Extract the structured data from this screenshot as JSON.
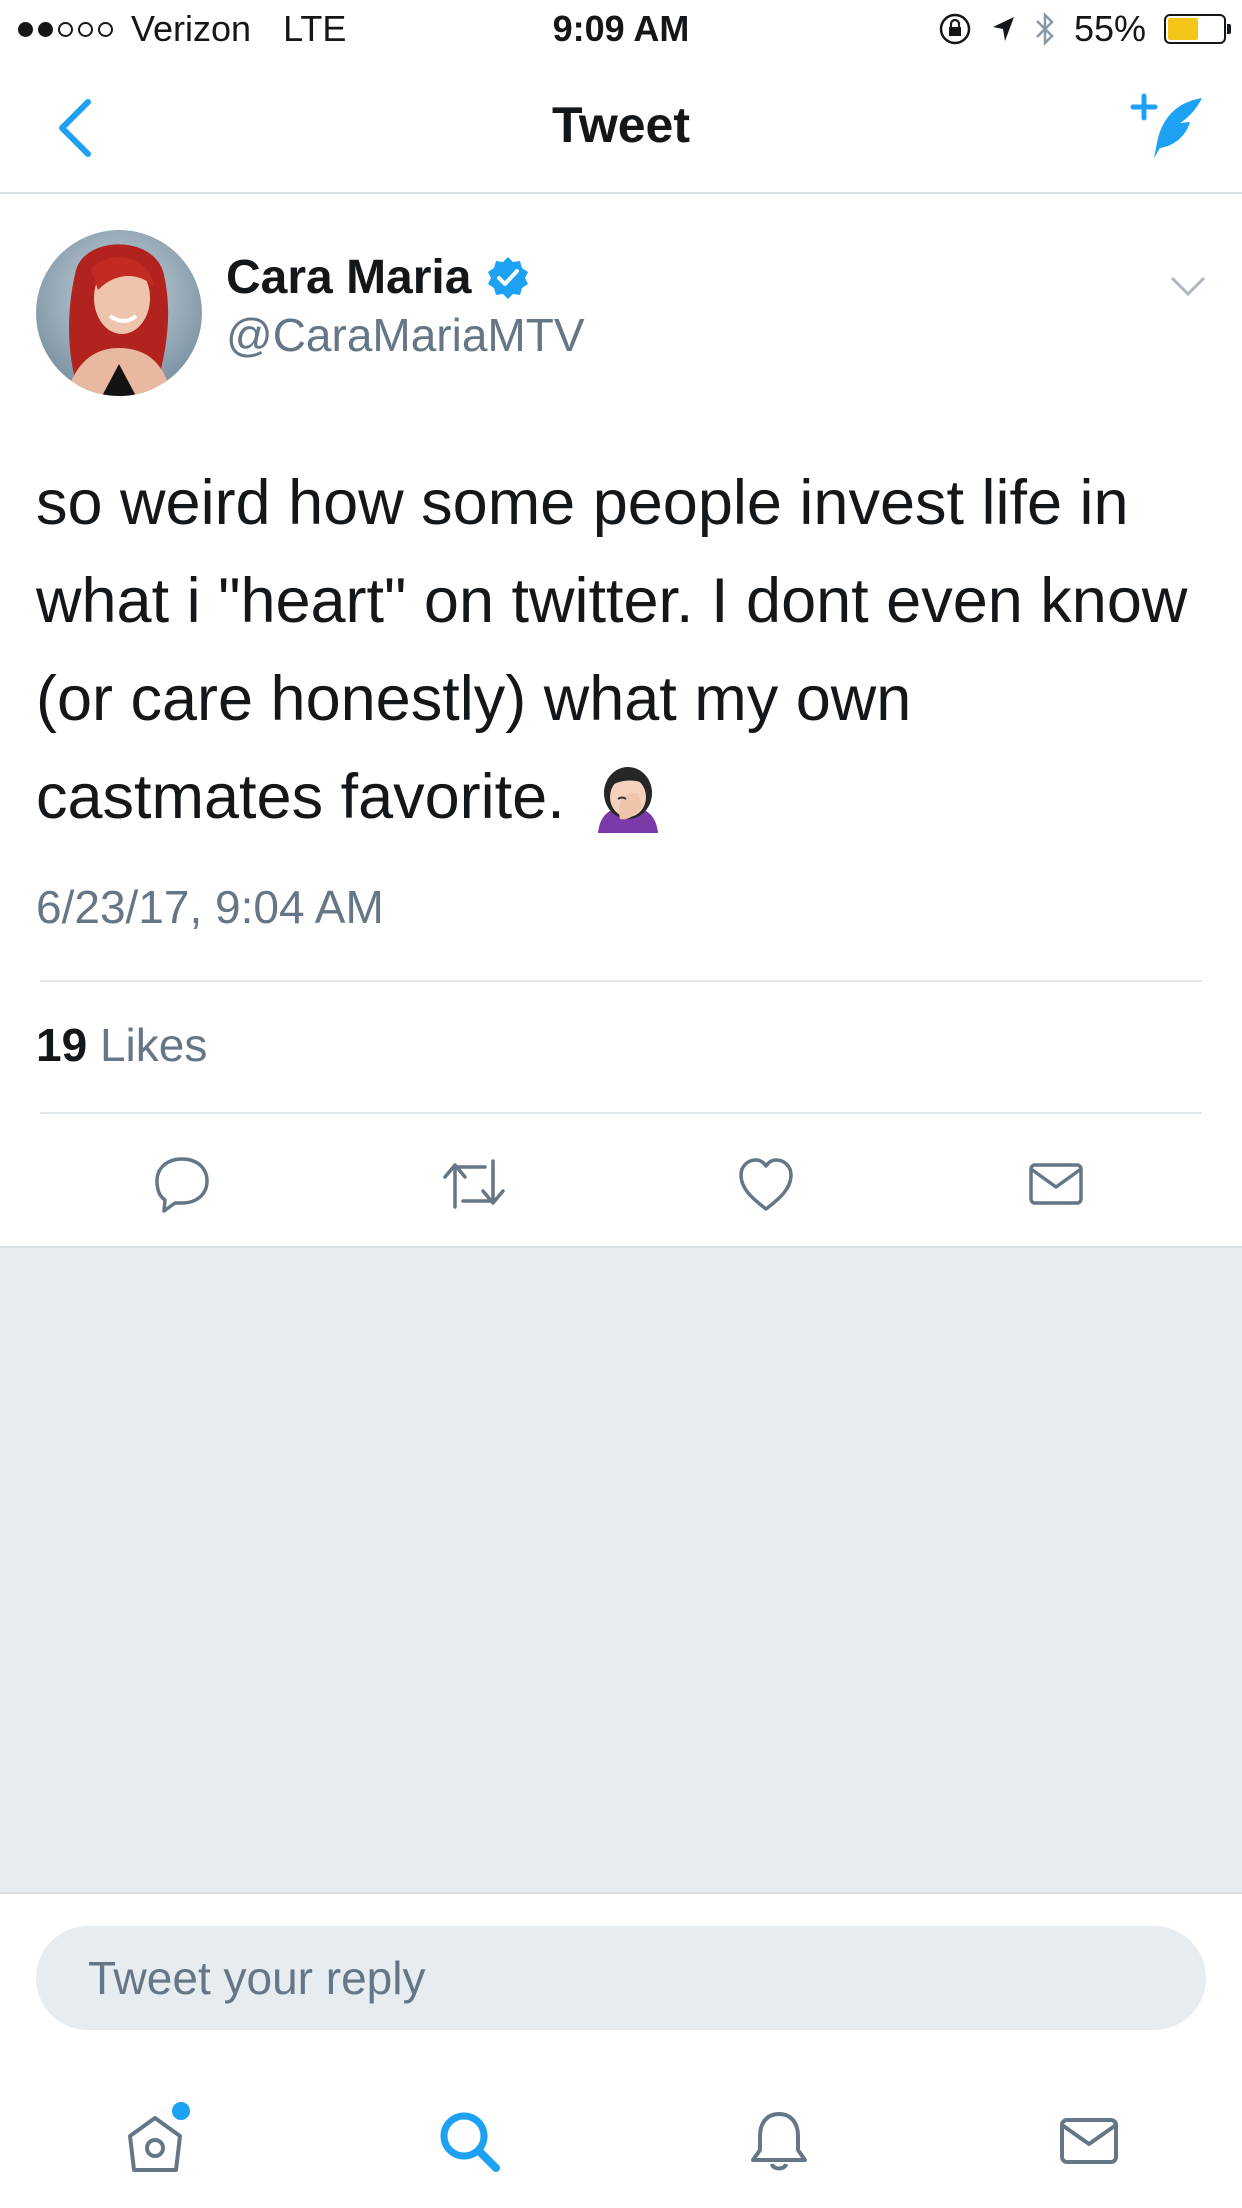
{
  "colors": {
    "accent": "#1da1f2",
    "text": "#14171a",
    "muted": "#657786",
    "empty_area": "#e6ecf0",
    "battery": "#f5c518"
  },
  "status_bar": {
    "carrier": "Verizon",
    "network": "LTE",
    "time": "9:09 AM",
    "battery_percent": "55%",
    "battery_level": 0.55
  },
  "nav": {
    "title": "Tweet"
  },
  "tweet": {
    "author_name": "Cara Maria",
    "author_handle": "@CaraMariaMTV",
    "verified": true,
    "text": "so weird how some people invest life in what i \"heart\" on twitter. I dont even know (or care honestly) what my own castmates favorite.",
    "emoji": "face-palm-woman-icon",
    "timestamp": "6/23/17, 9:04 AM",
    "likes_count": "19",
    "likes_label": "Likes"
  },
  "actions": [
    "reply-icon",
    "retweet-icon",
    "like-icon",
    "direct-message-icon"
  ],
  "reply": {
    "placeholder": "Tweet your reply"
  },
  "tabs": [
    "home-icon",
    "search-icon",
    "notifications-icon",
    "messages-icon"
  ]
}
